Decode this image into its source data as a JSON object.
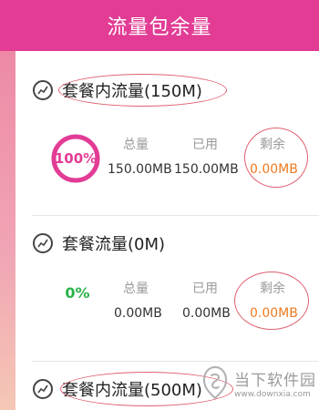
{
  "header": {
    "title": "流量包余量"
  },
  "colors": {
    "accent": "#e23c95",
    "remain": "#f07a21",
    "ok": "#2bb24a"
  },
  "packages": [
    {
      "title": "套餐内流量(150M)",
      "percent": "100%",
      "percent_value": 100,
      "total_label": "总量",
      "total_value": "150.00MB",
      "used_label": "已用",
      "used_value": "150.00MB",
      "remain_label": "剩余",
      "remain_value": "0.00MB"
    },
    {
      "title": "套餐流量(0M)",
      "percent": "0%",
      "percent_value": 0,
      "total_label": "总量",
      "total_value": "0.00MB",
      "used_label": "已用",
      "used_value": "0.00MB",
      "remain_label": "剩余",
      "remain_value": "0.00MB"
    },
    {
      "title": "套餐内流量(500M)"
    }
  ],
  "watermark": {
    "name": "当下软件园",
    "url": "www.downxia.com"
  }
}
